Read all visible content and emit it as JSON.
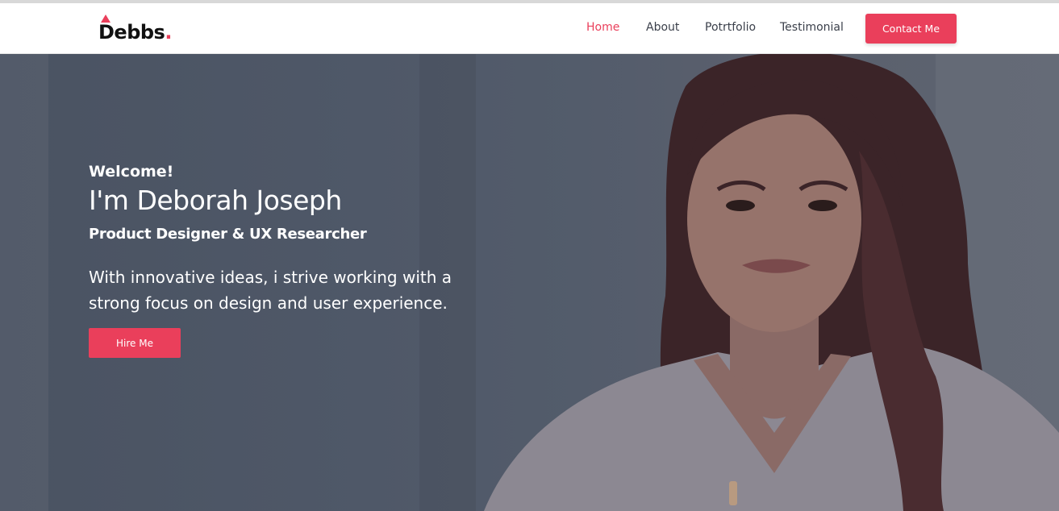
{
  "logo": {
    "text": "Debbs",
    "dot": "."
  },
  "nav": {
    "home": "Home",
    "about": "About",
    "portfolio": "Potrtfolio",
    "testimonial": "Testimonial",
    "contact_button": "Contact Me"
  },
  "hero": {
    "welcome": "Welcome!",
    "name": "I'm Deborah Joseph",
    "role": "Product Designer & UX Researcher",
    "tagline": "With innovative ideas, i strive working with a strong focus on design and user experience.",
    "hire_button": "Hire Me"
  },
  "colors": {
    "accent": "#ea3f5b",
    "nav_text": "#3a3f4a",
    "hero_overlay": "#4f5868"
  }
}
